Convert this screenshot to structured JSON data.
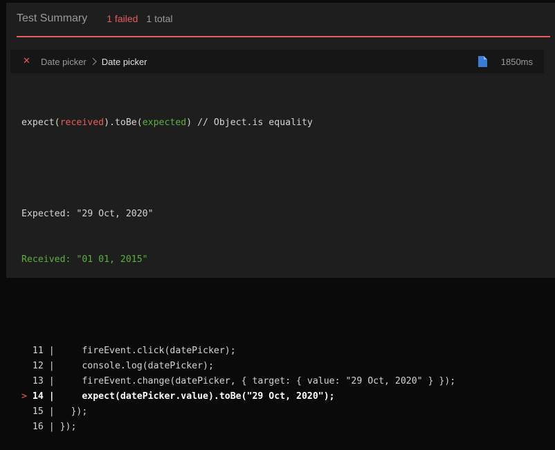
{
  "header": {
    "title": "Test Summary",
    "failed": "1 failed",
    "total": "1 total"
  },
  "test": {
    "status_icon": "x-icon",
    "breadcrumb": [
      "Date picker",
      "Date picker"
    ],
    "duration": "1850ms"
  },
  "assertion": {
    "prefix": "expect(",
    "received_word": "received",
    "middle": ").toBe(",
    "expected_word": "expected",
    "suffix": ") // Object.is equality",
    "expected_line": "Expected: \"29 Oct, 2020\"",
    "received_line": "Received: \"01 01, 2015\""
  },
  "code_lines": [
    {
      "marker": "  ",
      "num": "11",
      "sep": " |     ",
      "code": "fireEvent.click(datePicker);"
    },
    {
      "marker": "  ",
      "num": "12",
      "sep": " |     ",
      "code": "console.log(datePicker);"
    },
    {
      "marker": "  ",
      "num": "13",
      "sep": " |     ",
      "code": "fireEvent.change(datePicker, { target: { value: \"29 Oct, 2020\" } });"
    },
    {
      "marker": "> ",
      "num": "14",
      "sep": " |     ",
      "code": "expect(datePicker.value).toBe(\"29 Oct, 2020\");"
    },
    {
      "marker": "  ",
      "num": "15",
      "sep": " |   ",
      "code": "});"
    },
    {
      "marker": "  ",
      "num": "16",
      "sep": " | ",
      "code": "});"
    }
  ],
  "colors": {
    "failed": "#e85c5c",
    "received": "#5faf3f",
    "file_icon": "#3a7bd5"
  }
}
